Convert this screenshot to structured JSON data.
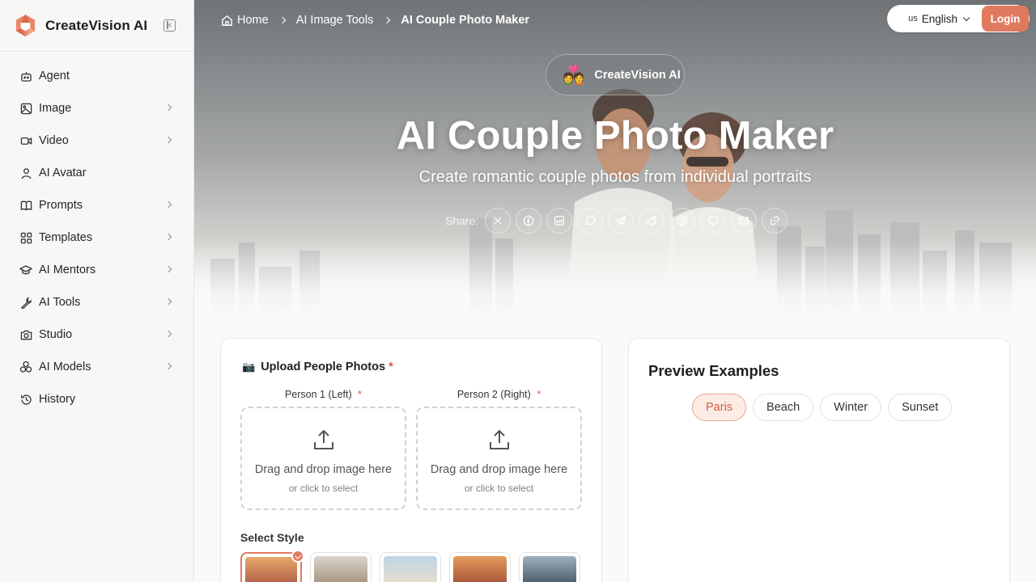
{
  "brand": {
    "name": "CreateVision AI"
  },
  "sidebar": {
    "items": [
      {
        "label": "Agent",
        "icon": "robot-icon",
        "has_submenu": false
      },
      {
        "label": "Image",
        "icon": "image-icon",
        "has_submenu": true
      },
      {
        "label": "Video",
        "icon": "video-icon",
        "has_submenu": true
      },
      {
        "label": "AI Avatar",
        "icon": "user-icon",
        "has_submenu": false
      },
      {
        "label": "Prompts",
        "icon": "book-icon",
        "has_submenu": true
      },
      {
        "label": "Templates",
        "icon": "grid-icon",
        "has_submenu": true
      },
      {
        "label": "AI Mentors",
        "icon": "graduation-cap-icon",
        "has_submenu": true
      },
      {
        "label": "AI Tools",
        "icon": "wrench-icon",
        "has_submenu": true
      },
      {
        "label": "Studio",
        "icon": "camera-icon",
        "has_submenu": true
      },
      {
        "label": "AI Models",
        "icon": "models-icon",
        "has_submenu": true
      },
      {
        "label": "History",
        "icon": "history-icon",
        "has_submenu": false
      }
    ]
  },
  "breadcrumb": {
    "home": "Home",
    "section": "AI Image Tools",
    "current": "AI Couple Photo Maker"
  },
  "language": {
    "flag": "us",
    "label": "English"
  },
  "login_label": "Login",
  "hero": {
    "badge_emoji": "💑",
    "badge_text": "CreateVision AI",
    "title": "AI Couple Photo Maker",
    "subtitle": "Create romantic couple photos from individual portraits",
    "share_label": "Share:",
    "share_icons": [
      "x-icon",
      "facebook-icon",
      "linkedin-icon",
      "whatsapp-icon",
      "telegram-icon",
      "reddit-icon",
      "pinterest-icon",
      "line-icon",
      "email-icon",
      "link-icon"
    ]
  },
  "upload": {
    "icon": "📷",
    "title": "Upload People Photos",
    "required_mark": "*",
    "person1_label": "Person 1 (Left)",
    "person2_label": "Person 2 (Right)",
    "drop_main": "Drag and drop image here",
    "drop_sub": "or click to select",
    "style_title": "Select Style"
  },
  "preview": {
    "title": "Preview Examples",
    "tabs": [
      "Paris",
      "Beach",
      "Winter",
      "Sunset"
    ],
    "active_tab": "Paris"
  },
  "colors": {
    "accent": "#e07a5f",
    "required": "#e0553d"
  }
}
